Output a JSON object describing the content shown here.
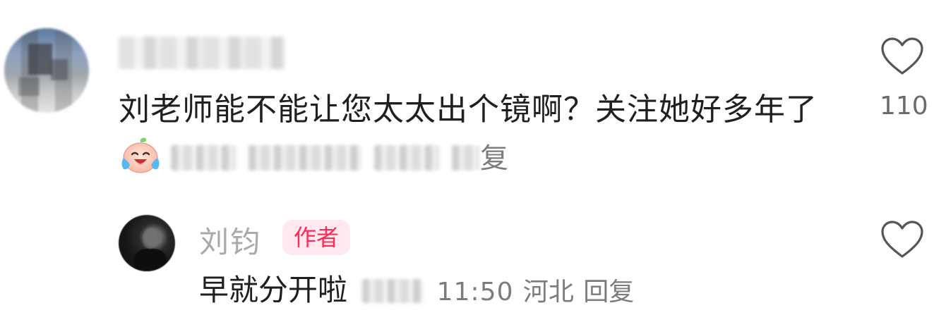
{
  "comment": {
    "text": "刘老师能不能让您太太出个镜啊？关注她好多年了",
    "emoji": "crying-laughing-face-emoji",
    "reply_label": "复",
    "like_count": "110"
  },
  "author_reply": {
    "name": "刘钧",
    "badge": "作者",
    "text": "早就分开啦",
    "time": "11:50",
    "location": "河北",
    "reply_label": "回复"
  },
  "colors": {
    "badge_bg": "#ffe9ee",
    "badge_text": "#ff2a55",
    "meta_text": "#7c7c7c",
    "name_text": "#a9a9a9"
  }
}
